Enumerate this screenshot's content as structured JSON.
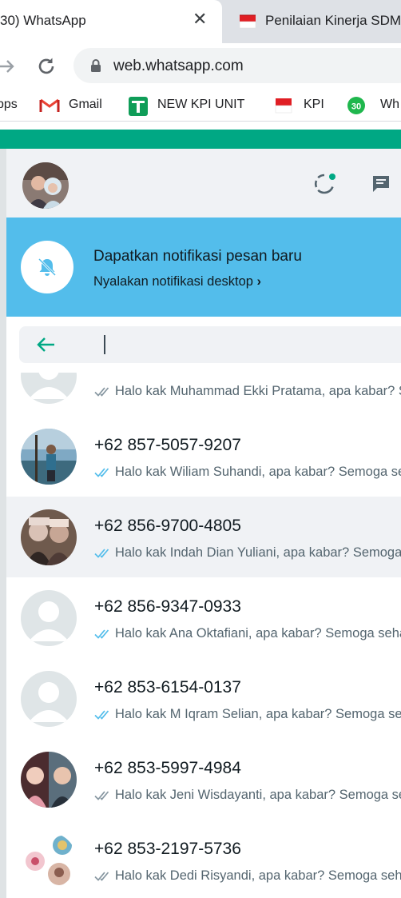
{
  "browser": {
    "active_tab": {
      "title": "30) WhatsApp",
      "close_glyph": "✕"
    },
    "inactive_tab": {
      "title": "Penilaian Kinerja SDM",
      "icon": "indonesia-flag-icon"
    },
    "url": "web.whatsapp.com",
    "bookmarks": [
      {
        "label": "pps",
        "icon": "none"
      },
      {
        "label": "Gmail",
        "icon": "gmail-icon"
      },
      {
        "label": "NEW KPI UNIT",
        "icon": "google-sheets-icon"
      },
      {
        "label": "KPI",
        "icon": "indonesia-flag-icon"
      },
      {
        "label": "Wh",
        "icon": "whatsapp-badge-icon",
        "badge": "30"
      }
    ]
  },
  "whatsapp": {
    "colors": {
      "brand_green": "#00a884",
      "notification_blue": "#53bdeb",
      "read_tick_blue": "#53bdeb",
      "delivered_tick_grey": "#8696a0",
      "selected_row": "#f0f2f5"
    },
    "notification": {
      "title": "Dapatkan notifikasi pesan baru",
      "link": "Nyalakan notifikasi desktop",
      "link_chevron": "›"
    },
    "search": {
      "value": "",
      "placeholder": ""
    },
    "chats": [
      {
        "name": "",
        "message": "Halo kak Muhammad Ekki Pratama, apa kabar? Semoga sehat selalu",
        "ticks": "grey",
        "avatar": "default",
        "selected": false
      },
      {
        "name": "+62 857-5057-9207",
        "message": "Halo kak Wiliam Suhandi, apa kabar? Semoga sehat selalu",
        "ticks": "blue",
        "avatar": "photo-outdoor",
        "selected": false
      },
      {
        "name": "+62 856-9700-4805",
        "message": "Halo kak Indah Dian Yuliani, apa kabar? Semoga sehat selalu",
        "ticks": "blue",
        "avatar": "photo-two-people",
        "selected": true
      },
      {
        "name": "+62 856-9347-0933",
        "message": "Halo kak Ana Oktafiani, apa kabar? Semoga sehat selalu",
        "ticks": "blue",
        "avatar": "default",
        "selected": false
      },
      {
        "name": "+62 853-6154-0137",
        "message": "Halo kak M Iqram Selian, apa kabar? Semoga sehat selalu",
        "ticks": "blue",
        "avatar": "default",
        "selected": false
      },
      {
        "name": "+62 853-5997-4984",
        "message": "Halo kak Jeni Wisdayanti, apa kabar? Semoga sehat selalu",
        "ticks": "grey",
        "avatar": "photo-collage",
        "selected": false
      },
      {
        "name": "+62 853-2197-5736",
        "message": "Halo kak Dedi Risyandi, apa kabar? Semoga sehat selalu",
        "ticks": "grey",
        "avatar": "photo-stickers",
        "selected": false
      }
    ]
  }
}
